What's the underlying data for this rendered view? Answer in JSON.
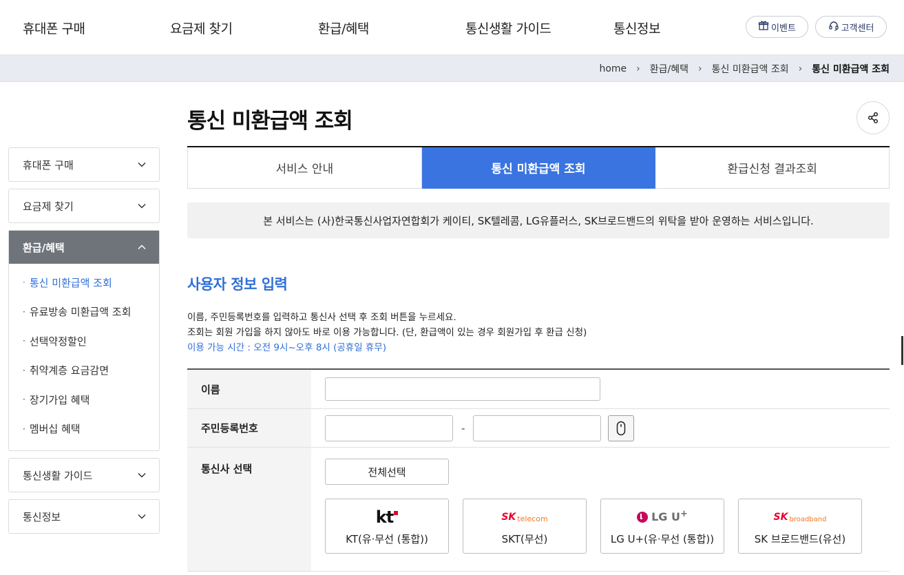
{
  "gnb": {
    "items": [
      "휴대폰 구매",
      "요금제 찾기",
      "환급/혜택",
      "통신생활 가이드",
      "통신정보"
    ],
    "event_label": "이벤트",
    "support_label": "고객센터"
  },
  "breadcrumb": {
    "home": "home",
    "level1": "환급/혜택",
    "level2": "통신 미환급액 조회",
    "current": "통신 미환급액 조회"
  },
  "sidebar": {
    "sections": [
      {
        "label": "휴대폰 구매",
        "open": false
      },
      {
        "label": "요금제 찾기",
        "open": false
      },
      {
        "label": "환급/혜택",
        "open": true,
        "items": [
          "통신 미환급액 조회",
          "유료방송 미환급액 조회",
          "선택약정할인",
          "취약계층 요금감면",
          "장기가입 혜택",
          "멤버십 혜택"
        ],
        "active_index": 0
      },
      {
        "label": "통신생활 가이드",
        "open": false
      },
      {
        "label": "통신정보",
        "open": false
      }
    ]
  },
  "main": {
    "title": "통신 미환급액 조회",
    "tabs": [
      "서비스 안내",
      "통신 미환급액 조회",
      "환급신청 결과조회"
    ],
    "active_tab": 1,
    "notice": "본 서비스는 (사)한국통신사업자연합회가 케이티, SK텔레콤, LG유플러스, SK브로드밴드의 위탁을 받아 운영하는 서비스입니다.",
    "section_title": "사용자 정보 입력",
    "guide_line1": "이름, 주민등록번호를 입력하고 통신사 선택 후 조회 버튼을 누르세요.",
    "guide_line2": "조회는 회원 가입을 하지 않아도 바로 이용 가능합니다. (단, 환급액이 있는 경우 회원가입 후 환급 신청)",
    "guide_hours": "이용 가능 시간 : 오전 9시~오후 8시 (공휴일 휴무)",
    "form": {
      "name_label": "이름",
      "rrn_label": "주민등록번호",
      "rrn_dash": "-",
      "carrier_label": "통신사 선택",
      "select_all": "전체선택",
      "carriers": [
        {
          "logo": "kt",
          "label": "KT(유·무선 (통합))"
        },
        {
          "logo": "SK telecom",
          "label": "SKT(무선)"
        },
        {
          "logo": "LG U+",
          "label": "LG U+(유·무선 (통합))"
        },
        {
          "logo": "SK broadband",
          "label": "SK 브로드밴드(유선)"
        }
      ]
    }
  },
  "colors": {
    "accent": "#3a74e0",
    "sidebar_open": "#6f747a",
    "kt_red": "#e4002b",
    "sk_red": "#ea002c",
    "sk_orange": "#f47725",
    "lg_magenta": "#c70a5b"
  }
}
